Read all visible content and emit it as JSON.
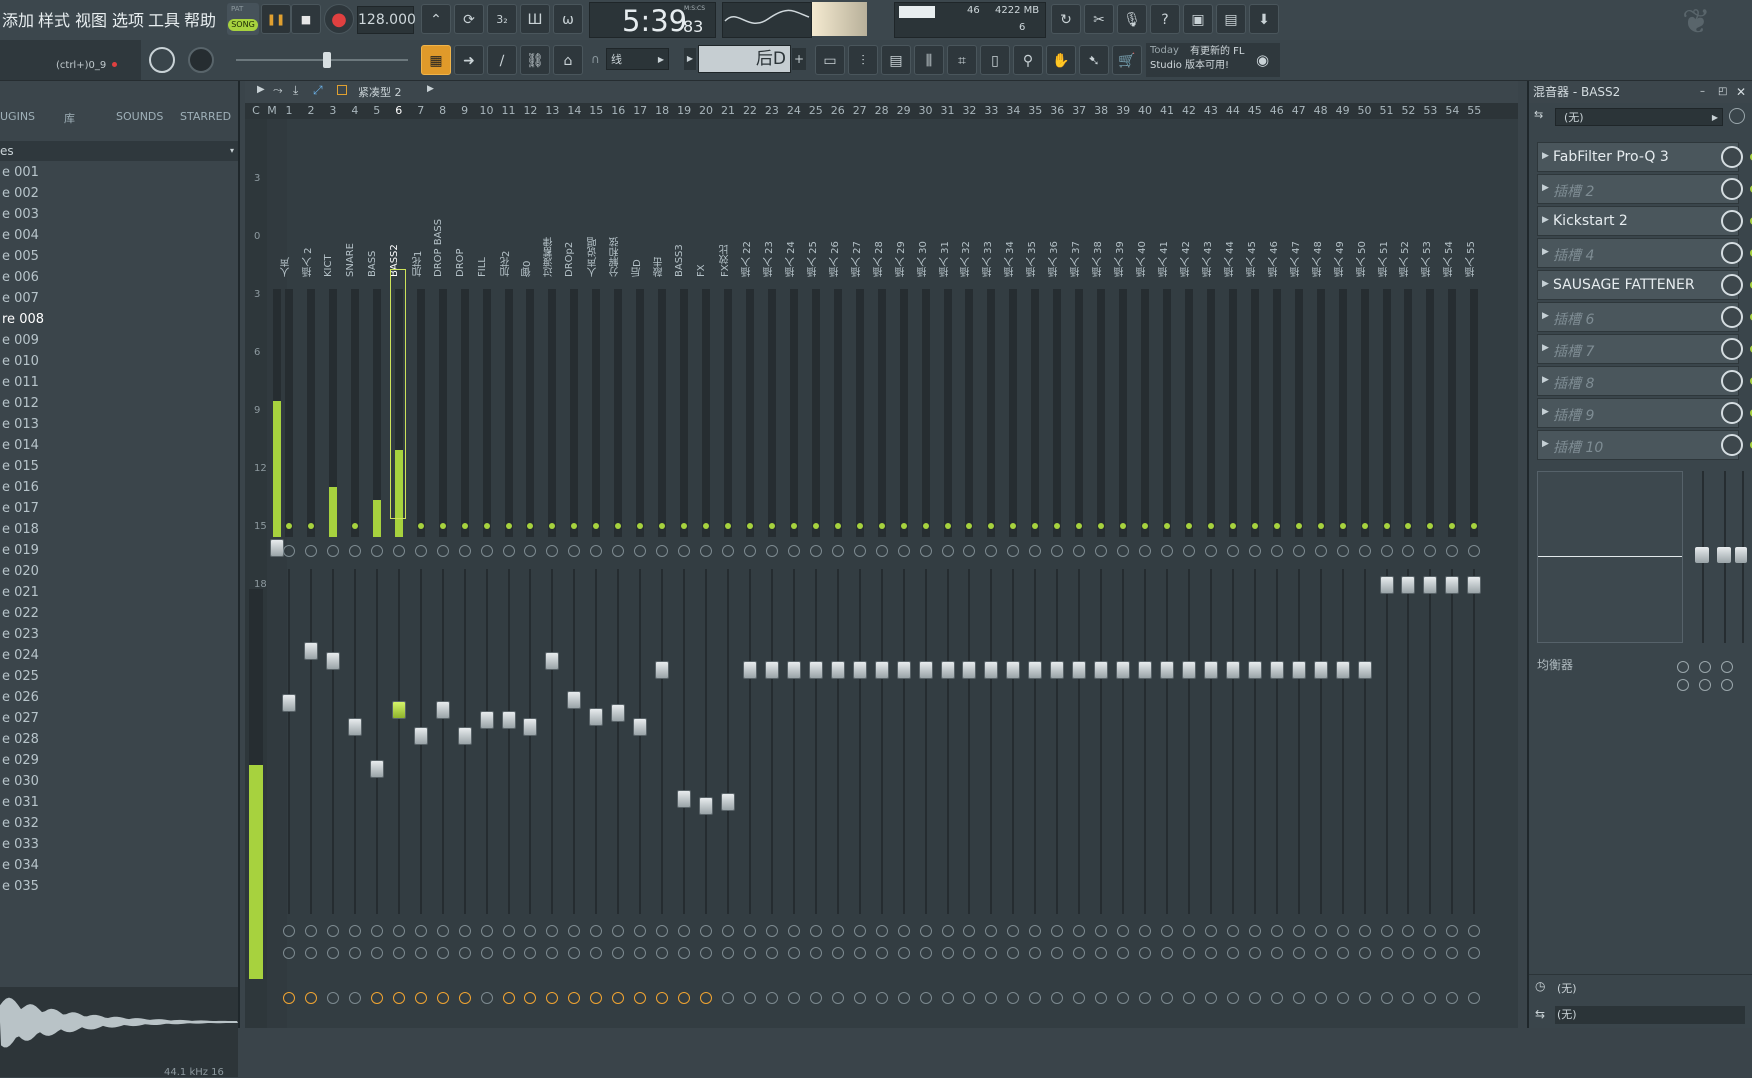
{
  "menu": [
    "添加",
    "样式",
    "视图",
    "选项",
    "工具",
    "帮助"
  ],
  "transport": {
    "pattern_label": "PAT",
    "song_label": "SONG",
    "play_icon": "pause-icon",
    "stop_icon": "stop-icon",
    "record_icon": "record-icon",
    "tempo": "128.000",
    "time_main": "5:39",
    "time_sub": "83",
    "time_unit": "M:S:CS",
    "cpu": "46",
    "memory": "4222 MB",
    "polyphony": "6"
  },
  "secondary": {
    "shortcut_hint": "(ctrl+)0_9",
    "snap": "线",
    "pattern_name": "后D",
    "news_today": "Today",
    "news_text": "有更新的 FL Studio 版本可用!"
  },
  "browser": {
    "tabs": [
      "UGINS",
      "库",
      "SOUNDS",
      "STARRED"
    ],
    "header": "es",
    "items": [
      "e 001",
      "e 002",
      "e 003",
      "e 004",
      "e 005",
      "e 006",
      "e 007",
      "re 008",
      "e 009",
      "e 010",
      "e 011",
      "e 012",
      "e 013",
      "e 014",
      "e 015",
      "e 016",
      "e 017",
      "e 018",
      "e 019",
      "e 020",
      "e 021",
      "e 022",
      "e 023",
      "e 024",
      "e 025",
      "e 026",
      "e 027",
      "e 028",
      "e 029",
      "e 030",
      "e 031",
      "e 032",
      "e 033",
      "e 034",
      "e 035"
    ],
    "selected_index": 7,
    "sample_rate": "44.1 kHz 16"
  },
  "mixer": {
    "preset_name": "紧凑型 2",
    "header_c": "C",
    "header_m": "M",
    "numbers": [
      "1",
      "2",
      "3",
      "4",
      "5",
      "6",
      "7",
      "8",
      "9",
      "10",
      "11",
      "12",
      "13",
      "14",
      "15",
      "16",
      "17",
      "18",
      "19",
      "20",
      "21",
      "22",
      "23",
      "24",
      "25",
      "26",
      "27",
      "28",
      "29",
      "30",
      "31",
      "32",
      "33",
      "34",
      "35",
      "36",
      "37",
      "38",
      "39",
      "40",
      "41",
      "42",
      "43",
      "44",
      "45",
      "46",
      "47",
      "48",
      "49",
      "50",
      "51",
      "52",
      "53",
      "54",
      "55"
    ],
    "names": [
      "人声",
      "插入 2",
      "KICT",
      "SNARE",
      "BASS",
      "BASS2",
      "加花1",
      "DROP BASS",
      "DROP",
      "FILL",
      "加花2",
      "御0",
      "过渡蓄律",
      "DROp2",
      "人声说唱",
      "分解和弦",
      "后D",
      "敲击",
      "BASS3",
      "FX",
      "FX效比",
      "插入 22",
      "插入 23",
      "插入 24",
      "插入 25",
      "插入 26",
      "插入 27",
      "插入 28",
      "插入 29",
      "插入 30",
      "插入 31",
      "插入 32",
      "插入 33",
      "插入 34",
      "插入 35",
      "插入 36",
      "插入 37",
      "插入 38",
      "插入 39",
      "插入 40",
      "插入 41",
      "插入 42",
      "插入 43",
      "插入 44",
      "插入 45",
      "插入 46",
      "插入 47",
      "插入 48",
      "插入 49",
      "插入 50",
      "插入 51",
      "插入 52",
      "插入 53",
      "插入 54",
      "插入 55"
    ],
    "selected_index": 5,
    "fader_levels": [
      0.62,
      0.78,
      0.75,
      0.55,
      0.42,
      0.6,
      0.52,
      0.6,
      0.52,
      0.57,
      0.57,
      0.55,
      0.75,
      0.63,
      0.58,
      0.59,
      0.55,
      0.72,
      0.33,
      0.31,
      0.32,
      0.72,
      0.72,
      0.72,
      0.72,
      0.72,
      0.72,
      0.72,
      0.72,
      0.72,
      0.72,
      0.72,
      0.72,
      0.72,
      0.72,
      0.72,
      0.72,
      0.72,
      0.72,
      0.72,
      0.72,
      0.72,
      0.72,
      0.72,
      0.72,
      0.72,
      0.72,
      0.72,
      0.72,
      0.72,
      0.98,
      0.98,
      0.98,
      0.98,
      0.98
    ],
    "meter_levels": [
      0,
      0,
      0.2,
      0,
      0.15,
      0.35,
      0,
      0,
      0,
      0,
      0,
      0,
      0,
      0,
      0,
      0,
      0,
      0,
      0,
      0,
      0,
      0,
      0,
      0,
      0,
      0,
      0,
      0,
      0,
      0,
      0,
      0,
      0,
      0,
      0,
      0,
      0,
      0,
      0,
      0,
      0,
      0,
      0,
      0,
      0,
      0,
      0,
      0,
      0,
      0,
      0,
      0,
      0,
      0,
      0
    ],
    "master_meter": 0.55,
    "orange_knobs": [
      0,
      1,
      4,
      5,
      6,
      7,
      8,
      10,
      11,
      12,
      13,
      14,
      15,
      16,
      17,
      18,
      19
    ],
    "db_scale": [
      "3",
      "0",
      "3",
      "6",
      "9",
      "12",
      "15",
      "18"
    ]
  },
  "channel": {
    "title": "混音器 - BASS2",
    "input": "(无)",
    "slots": [
      {
        "label": "FabFilter Pro-Q 3",
        "empty": false
      },
      {
        "label": "插槽 2",
        "empty": true
      },
      {
        "label": "Kickstart 2",
        "empty": false
      },
      {
        "label": "插槽 4",
        "empty": true
      },
      {
        "label": "SAUSAGE FATTENER",
        "empty": false
      },
      {
        "label": "插槽 6",
        "empty": true
      },
      {
        "label": "插槽 7",
        "empty": true
      },
      {
        "label": "插槽 8",
        "empty": true
      },
      {
        "label": "插槽 9",
        "empty": true
      },
      {
        "label": "插槽 10",
        "empty": true
      }
    ],
    "eq_label": "均衡器",
    "output_1": "(无)",
    "output_2": "(无)"
  }
}
